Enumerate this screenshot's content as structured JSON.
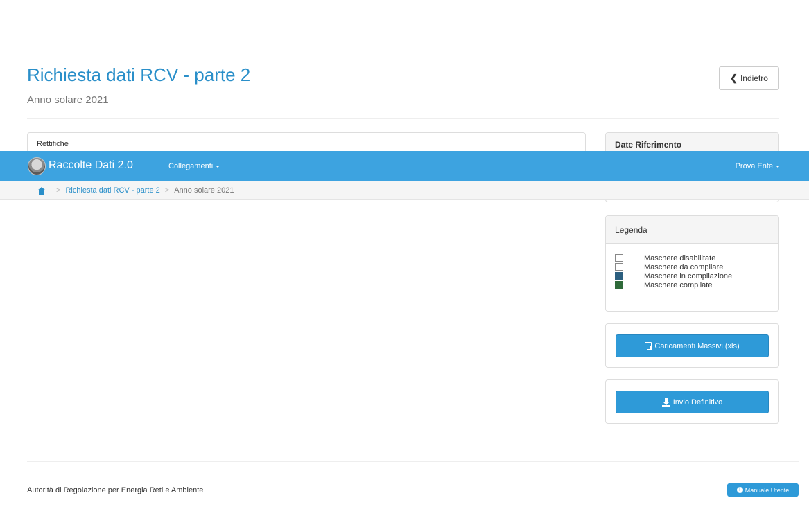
{
  "page": {
    "title": "Richiesta dati RCV - parte 2",
    "subtitle": "Anno solare 2021",
    "back_label": "Indietro"
  },
  "panels": {
    "rettifiche_title": "Rettifiche",
    "date_riferimento_title": "Date Riferimento",
    "legenda_title": "Legenda"
  },
  "legend": [
    {
      "label": "Maschere disabilitate",
      "color": "#ffffff"
    },
    {
      "label": "Maschere da compilare",
      "color": "#ffffff"
    },
    {
      "label": "Maschere in compilazione",
      "color": "#2c5f7f"
    },
    {
      "label": "Maschere compilate",
      "color": "#2f6a3a"
    }
  ],
  "actions": {
    "massivi_label": "Caricamenti Massivi (xls)",
    "invio_label": "Invio Definitivo"
  },
  "navbar": {
    "brand": "Raccolte Dati 2.0",
    "collegamenti": "Collegamenti",
    "user": "Prova Ente",
    "bg_color": "#3da3e0"
  },
  "breadcrumb": {
    "item1": "Richiesta dati RCV - parte 2",
    "item2": "Anno solare 2021",
    "separator": ">"
  },
  "footer": {
    "text": "Autorità di Regolazione per Energia Reti e Ambiente",
    "manual_label": "Manuale Utente"
  }
}
